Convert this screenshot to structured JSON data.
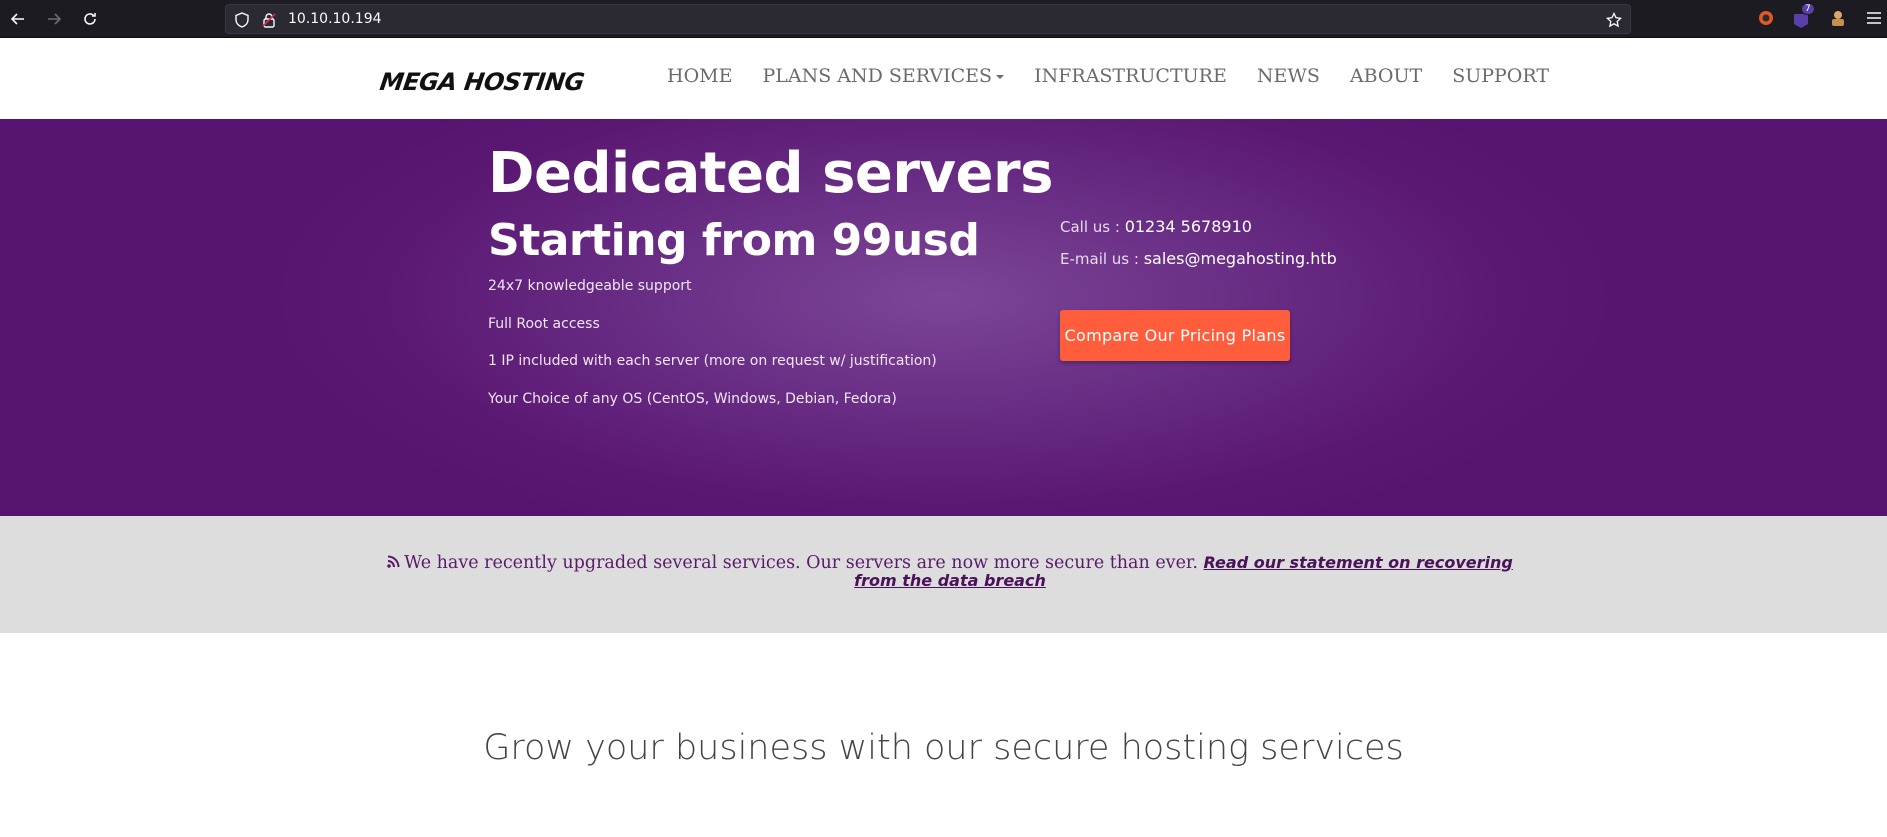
{
  "browser": {
    "url": "10.10.10.194",
    "extension_badge": "7"
  },
  "header": {
    "logo": "MEGA HOSTING",
    "nav": [
      {
        "label": "HOME"
      },
      {
        "label": "PLANS AND SERVICES"
      },
      {
        "label": "INFRASTRUCTURE"
      },
      {
        "label": "NEWS"
      },
      {
        "label": "ABOUT"
      },
      {
        "label": "SUPPORT"
      }
    ]
  },
  "hero": {
    "title": "Dedicated servers",
    "subtitle": "Starting from 99usd",
    "features": [
      "24x7 knowledgeable support",
      "Full Root access",
      "1 IP included with each server (more on request w/ justification)",
      "Your Choice of any OS (CentOS, Windows, Debian, Fedora)"
    ],
    "call_label": "Call us : ",
    "call_value": "01234 5678910",
    "email_label": "E-mail us : ",
    "email_value": "sales@megahosting.htb",
    "cta_label": "Compare Our Pricing Plans"
  },
  "announcement": {
    "text": "We have recently upgraded several services. Our servers are now more secure than ever.",
    "link_text": "Read our statement on recovering from the data breach"
  },
  "section": {
    "heading": "Grow your business with our secure hosting services"
  },
  "colors": {
    "hero_purple": "#5b1873",
    "cta_orange": "#ff5d3c",
    "announce_bg": "#dddddd",
    "announce_text": "#5a1a6a"
  }
}
